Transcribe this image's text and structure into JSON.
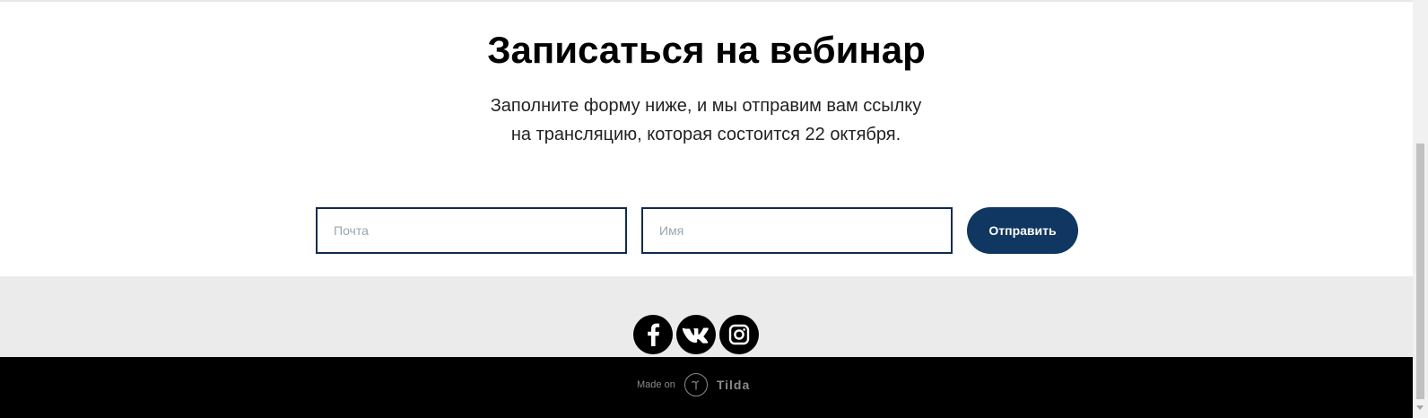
{
  "form": {
    "title": "Записаться на вебинар",
    "subtitle_line1": "Заполните форму ниже, и мы отправим вам ссылку",
    "subtitle_line2": "на трансляцию, которая состоится 22 октября.",
    "email_placeholder": "Почта",
    "email_value": "",
    "name_placeholder": "Имя",
    "name_value": "",
    "submit_label": "Отправить"
  },
  "social": {
    "icons": [
      "facebook-icon",
      "vk-icon",
      "instagram-icon"
    ]
  },
  "footer": {
    "made_on": "Made on",
    "brand": "Tilda"
  },
  "colors": {
    "accent": "#0f3761",
    "input_border": "#0f2b4f",
    "social_bg": "#ebebeb",
    "footer_bg": "#000000"
  }
}
